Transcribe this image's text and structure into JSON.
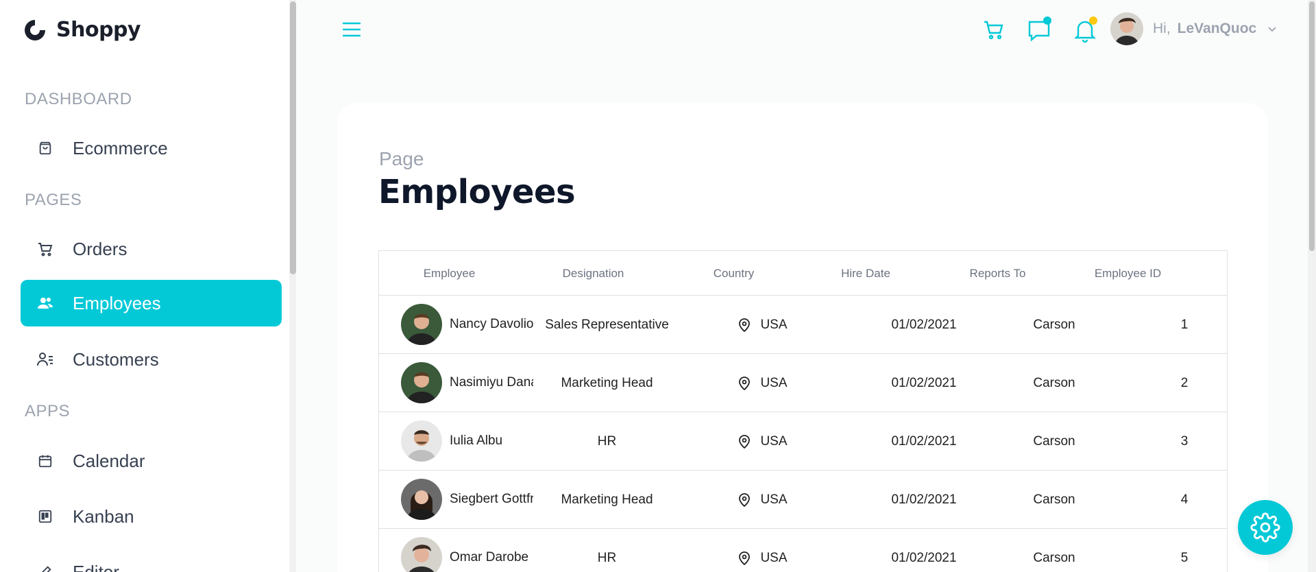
{
  "app": {
    "name": "Shoppy"
  },
  "sidebar": {
    "sections": [
      {
        "title": "DASHBOARD"
      },
      {
        "title": "PAGES"
      },
      {
        "title": "APPS"
      }
    ],
    "items": [
      {
        "label": "Ecommerce",
        "icon": "shopping-bag-icon"
      },
      {
        "label": "Orders",
        "icon": "cart-icon"
      },
      {
        "label": "Employees",
        "icon": "users-icon",
        "active": true
      },
      {
        "label": "Customers",
        "icon": "user-list-icon"
      },
      {
        "label": "Calendar",
        "icon": "calendar-icon"
      },
      {
        "label": "Kanban",
        "icon": "kanban-icon"
      },
      {
        "label": "Editor",
        "icon": "edit-icon"
      }
    ]
  },
  "header": {
    "greeting": "Hi,",
    "username": "LeVanQuoc"
  },
  "page": {
    "breadcrumb": "Page",
    "title": "Employees"
  },
  "grid": {
    "columns": [
      "Employee",
      "Designation",
      "Country",
      "Hire Date",
      "Reports To",
      "Employee ID"
    ],
    "rows": [
      {
        "name": "Nancy Davolio",
        "designation": "Sales Representative",
        "country": "USA",
        "hire_date": "01/02/2021",
        "reports_to": "Carson",
        "id": "1"
      },
      {
        "name": "Nasimiyu Danai",
        "designation": "Marketing Head",
        "country": "USA",
        "hire_date": "01/02/2021",
        "reports_to": "Carson",
        "id": "2"
      },
      {
        "name": "Iulia Albu",
        "designation": "HR",
        "country": "USA",
        "hire_date": "01/02/2021",
        "reports_to": "Carson",
        "id": "3"
      },
      {
        "name": "Siegbert Gottfried",
        "designation": "Marketing Head",
        "country": "USA",
        "hire_date": "01/02/2021",
        "reports_to": "Carson",
        "id": "4"
      },
      {
        "name": "Omar Darobe",
        "designation": "HR",
        "country": "USA",
        "hire_date": "01/02/2021",
        "reports_to": "Carson",
        "id": "5"
      }
    ]
  },
  "colors": {
    "accent": "#03c9d7",
    "chat_dot": "#03c9d7",
    "bell_dot": "#fec90f"
  }
}
